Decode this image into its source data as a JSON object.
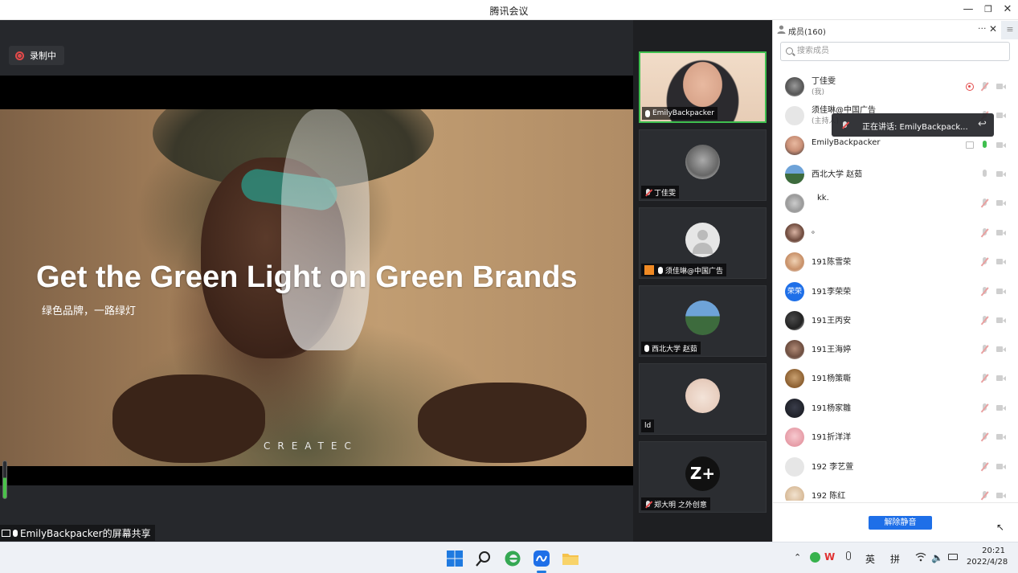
{
  "window": {
    "title": "腾讯会议",
    "minimize_icon": "minimize-icon",
    "restore_icon": "restore-icon",
    "close_icon": "close-icon"
  },
  "recording": {
    "label": "录制中"
  },
  "slide": {
    "title": "Get the Green Light on Green Brands",
    "subtitle": "绿色品牌，一路绿灯",
    "brand": "CREATEC"
  },
  "screen_share": {
    "label": "EmilyBackpacker的屏幕共享"
  },
  "video_tiles": [
    {
      "name": "EmilyBackpacker",
      "mic": "on",
      "active": true
    },
    {
      "name": "丁佳雯",
      "mic": "muted"
    },
    {
      "name": "须佳琳@中国广告",
      "mic": "on",
      "host": true
    },
    {
      "name": "西北大学 赵茹",
      "mic": "on"
    },
    {
      "name": "ld",
      "mic": "none"
    },
    {
      "name": "郑大明 之外创意",
      "mic": "muted",
      "avatar_text": "Z+"
    }
  ],
  "members": {
    "title": "成员(160)",
    "more_label": "···",
    "search_placeholder": "搜索成员",
    "list": [
      {
        "name": "丁佳雯",
        "role": "(我)",
        "status": "recording"
      },
      {
        "name": "须佳琳@中国广告",
        "role": "(主持人)"
      },
      {
        "name": "EmilyBackpacker",
        "status": "sharing",
        "mic": "on"
      },
      {
        "name": "西北大学 赵茹",
        "mic": "off"
      },
      {
        "name": "kk."
      },
      {
        "name": "。"
      },
      {
        "name": "191陈雪荣"
      },
      {
        "name": "191李荣荣",
        "avatar_text": "荣荣"
      },
      {
        "name": "191王丙安"
      },
      {
        "name": "191王海婷"
      },
      {
        "name": "191杨策嘶"
      },
      {
        "name": "191杨家雛"
      },
      {
        "name": "191折洋洋"
      },
      {
        "name": "192 李艺萱"
      },
      {
        "name": "192 陈红"
      }
    ],
    "speaking_label": "正在讲话: EmilyBackpack...",
    "unmute_all_label": "解除静音"
  },
  "taskbar": {
    "apps": [
      "windows-start-icon",
      "search-icon",
      "edge-icon",
      "tencent-meeting-icon",
      "file-explorer-icon"
    ],
    "tray_lang": "英",
    "tray_ime": "拼",
    "time": "20:21",
    "date": "2022/4/28"
  }
}
